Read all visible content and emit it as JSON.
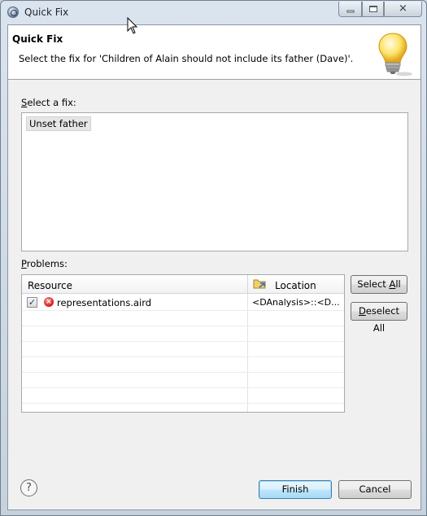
{
  "window": {
    "title": "Quick Fix"
  },
  "header": {
    "title": "Quick Fix",
    "message": "Select the fix for 'Children of Alain should not include its father (Dave)'."
  },
  "fixes": {
    "label_prefix": "S",
    "label_rest": "elect a fix:",
    "items": [
      {
        "label": "Unset father"
      }
    ]
  },
  "problems": {
    "label_prefix": "P",
    "label_rest": "roblems:",
    "columns": {
      "resource": "Resource",
      "location": "Location"
    },
    "rows": [
      {
        "checked": true,
        "status": "error",
        "resource": "representations.aird",
        "location": "<DAnalysis>::<D..."
      }
    ],
    "select_all": {
      "pre": "Select ",
      "key": "A",
      "post": "ll"
    },
    "deselect_all": {
      "pre": "",
      "key": "D",
      "post": "eselect All"
    }
  },
  "footer": {
    "finish_label": "Finish",
    "cancel_label": "Cancel",
    "help_glyph": "?"
  },
  "icons": {
    "window": "eclipse-app-icon",
    "header": "lightbulb-icon",
    "location_column": "folder-link-icon",
    "row_status": "error-icon",
    "help": "help-icon"
  },
  "colors": {
    "default_button": "#a7d9f5",
    "error": "#d81e1e",
    "bulb": "#ffd84a"
  }
}
